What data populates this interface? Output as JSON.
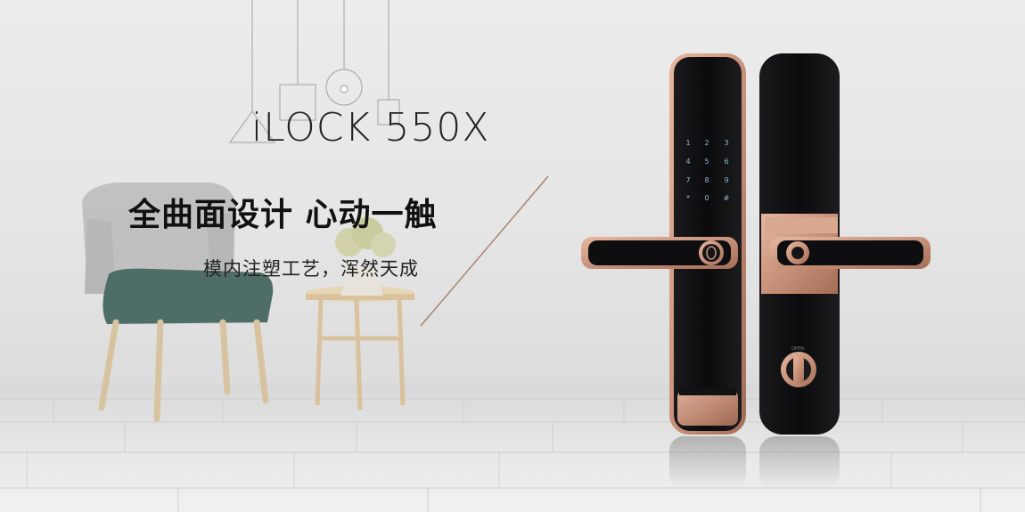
{
  "banner": {
    "product_name": "iLOCK 550X",
    "headline": "全曲面设计  心动一触",
    "subheadline": "模内注塑工艺，浑然天成"
  },
  "colors": {
    "wall": "#e6e6e6",
    "floor": "#e9e9e9",
    "lock_body": "#0d0d0f",
    "lock_trim": "#c9927a",
    "chair_seat": "#3e6159",
    "chair_back": "#b9b9b9",
    "table_wood": "#e5cfaa",
    "accent_line": "#a77e6a"
  },
  "images": [
    {
      "name": "background-interior-scene",
      "depicts": "room with armchair, side table and pendant lamps"
    },
    {
      "name": "smart-lock-front",
      "depicts": "black smart lock with rose-gold trim, keypad and fingerprint handle"
    },
    {
      "name": "smart-lock-back",
      "depicts": "inner side of smart lock with rose-gold panel and knob"
    }
  ],
  "keypad": [
    "1",
    "2",
    "3",
    "4",
    "5",
    "6",
    "7",
    "8",
    "9",
    "0"
  ]
}
